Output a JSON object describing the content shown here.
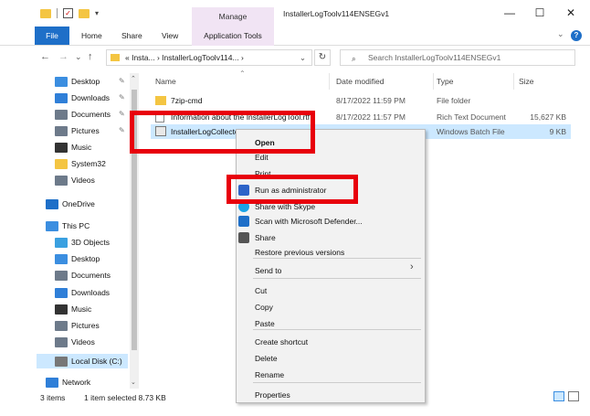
{
  "title_bar": {
    "manage_tab": "Manage",
    "window_title": "InstallerLogToolv114ENSEGv1",
    "minimize": "—",
    "maximize": "☐",
    "close": "✕"
  },
  "ribbon": {
    "tabs": [
      "File",
      "Home",
      "Share",
      "View"
    ],
    "app_tools": "Application Tools",
    "help": "?"
  },
  "nav": {
    "back": "←",
    "forward": "→",
    "dropdown": "⌄",
    "up": "↑",
    "address": "« Insta...  ›  InstallerLogToolv114...  ›",
    "address_chevron": "⌄",
    "refresh": "↻",
    "search_placeholder": "Search InstallerLogToolv114ENSEGv1"
  },
  "sidebar": {
    "items": [
      {
        "label": "Desktop",
        "color": "#3b8ee0"
      },
      {
        "label": "Downloads",
        "color": "#2f7fd8"
      },
      {
        "label": "Documents",
        "color": "#6d7a8a"
      },
      {
        "label": "Pictures",
        "color": "#6d7a8a"
      },
      {
        "label": "Music",
        "color": "#333333"
      },
      {
        "label": "System32",
        "color": "#f4c542"
      },
      {
        "label": "Videos",
        "color": "#6d7a8a"
      },
      {
        "label": "OneDrive",
        "color": "#1e6fc8"
      },
      {
        "label": "This PC",
        "color": "#3b8ee0"
      },
      {
        "label": "3D Objects",
        "color": "#3aa0e0"
      },
      {
        "label": "Desktop",
        "color": "#3b8ee0"
      },
      {
        "label": "Documents",
        "color": "#6d7a8a"
      },
      {
        "label": "Downloads",
        "color": "#2f7fd8"
      },
      {
        "label": "Music",
        "color": "#333333"
      },
      {
        "label": "Pictures",
        "color": "#6d7a8a"
      },
      {
        "label": "Videos",
        "color": "#6d7a8a"
      },
      {
        "label": "Local Disk (C:)",
        "color": "#777777"
      },
      {
        "label": "Network",
        "color": "#2f7fd8"
      }
    ],
    "pin": "📌"
  },
  "columns": {
    "name": "Name",
    "date": "Date modified",
    "type": "Type",
    "size": "Size"
  },
  "files": [
    {
      "name": "7zip-cmd",
      "date": "8/17/2022 11:59 PM",
      "type": "File folder",
      "size": ""
    },
    {
      "name": "Information about the InstallerLogTool.rtf",
      "date": "8/17/2022 11:57 PM",
      "type": "Rich Text Document",
      "size": "15,627 KB"
    },
    {
      "name": "InstallerLogCollectorEN.bat",
      "date": "8/17/2022 11:46 PM",
      "type": "Windows Batch File",
      "size": "9 KB"
    }
  ],
  "status": {
    "items": "3 items",
    "selected": "1 item selected  8.73 KB"
  },
  "context_menu": {
    "items": [
      "Open",
      "Edit",
      "Print",
      "Run as administrator",
      "Share with Skype",
      "Scan with Microsoft Defender...",
      "Share",
      "Restore previous versions",
      "Send to",
      "Cut",
      "Copy",
      "Paste",
      "Create shortcut",
      "Delete",
      "Rename",
      "Properties"
    ],
    "submenu_arrow": "›"
  },
  "colors": {
    "accent": "#1e6fc8",
    "highlight": "#e8000b",
    "selection": "#cce8ff"
  }
}
